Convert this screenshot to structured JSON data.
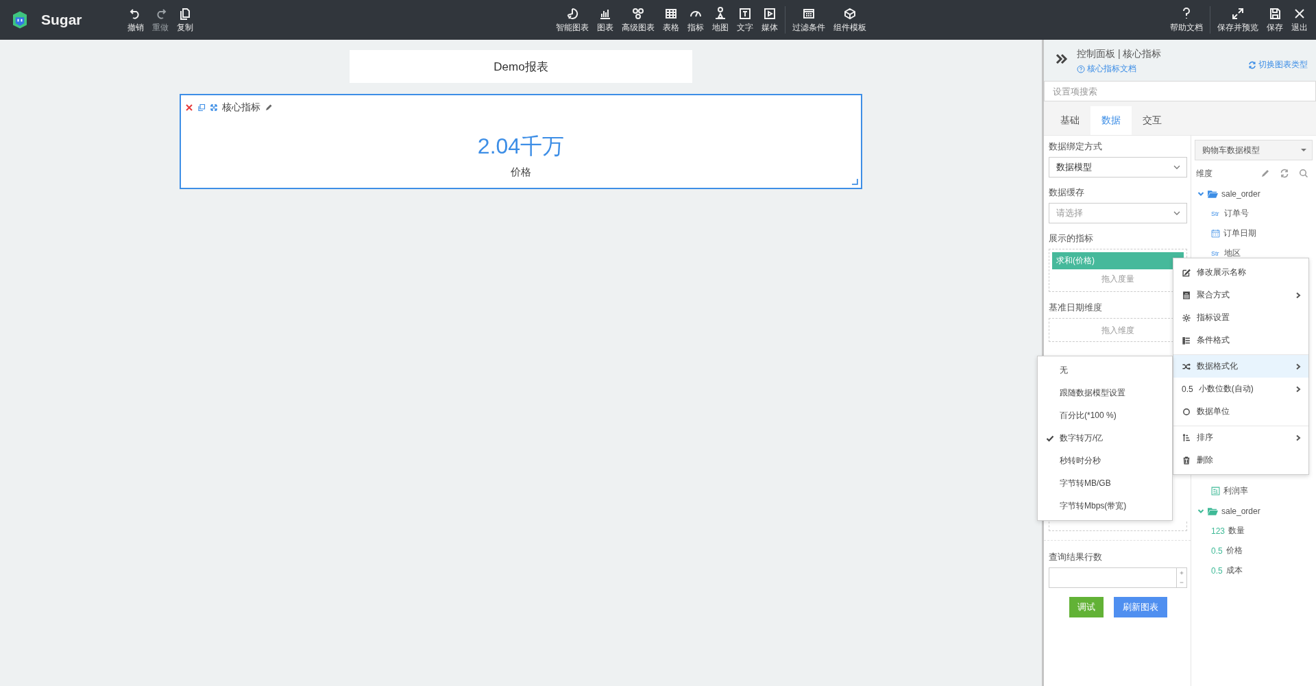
{
  "app": {
    "name": "Sugar"
  },
  "toolbar": {
    "left": [
      {
        "label": "撤销",
        "disabled": false
      },
      {
        "label": "重做",
        "disabled": true
      },
      {
        "label": "复制",
        "disabled": false
      }
    ],
    "center": [
      [
        {
          "label": "智能图表"
        },
        {
          "label": "图表"
        },
        {
          "label": "高级图表"
        },
        {
          "label": "表格"
        },
        {
          "label": "指标"
        },
        {
          "label": "地图"
        },
        {
          "label": "文字"
        },
        {
          "label": "媒体"
        }
      ],
      [
        {
          "label": "过滤条件"
        },
        {
          "label": "组件模板"
        }
      ]
    ],
    "right": [
      [
        {
          "label": "帮助文档"
        }
      ],
      [
        {
          "label": "保存并预览"
        },
        {
          "label": "保存"
        },
        {
          "label": "退出"
        }
      ]
    ]
  },
  "report": {
    "title": "Demo报表",
    "widget": {
      "title": "核心指标",
      "value": "2.04千万",
      "caption": "价格",
      "selected": true
    }
  },
  "panel": {
    "title": "控制面板 | 核心指标",
    "doc_link": "核心指标文档",
    "switch_link": "切换图表类型",
    "search": {
      "placeholder": "设置项搜索"
    },
    "tabs": [
      {
        "label": "基础",
        "selected": false
      },
      {
        "label": "数据",
        "selected": true
      },
      {
        "label": "交互",
        "selected": false
      }
    ],
    "settings": {
      "binding": {
        "label": "数据绑定方式",
        "value": "数据模型"
      },
      "cache": {
        "label": "数据缓存",
        "placeholder": "请选择"
      },
      "metrics": {
        "label": "展示的指标",
        "chips": [
          "求和(价格)"
        ],
        "drop_hint": "拖入度量"
      },
      "date_dim": {
        "label": "基准日期维度",
        "drop_hint": "拖入维度"
      },
      "row_limit": {
        "label": "查询结果行数"
      },
      "buttons": [
        {
          "label": "调试",
          "kind": "success"
        },
        {
          "label": "刷新图表",
          "kind": "primary"
        }
      ]
    },
    "model": {
      "selected": "购物车数据模型",
      "dimensions_label": "维度",
      "tree": [
        {
          "kind": "folder",
          "label": "sale_order",
          "expanded": true,
          "color": "#3d8ee6",
          "children": [
            {
              "kind": "tag",
              "tag": "Str",
              "label": "订单号"
            },
            {
              "kind": "date",
              "label": "订单日期"
            },
            {
              "kind": "tag",
              "tag": "Str",
              "label": "地区"
            }
          ]
        },
        {
          "kind": "calc",
          "label": "利润率"
        },
        {
          "kind": "folder",
          "label": "sale_order",
          "expanded": true,
          "color": "#3fba97",
          "children": [
            {
              "kind": "tag",
              "tag": "123",
              "label": "数量"
            },
            {
              "kind": "tag",
              "tag": "0.5",
              "label": "价格"
            },
            {
              "kind": "tag",
              "tag": "0.5",
              "label": "成本"
            }
          ]
        }
      ]
    }
  },
  "context_menu": {
    "items": [
      {
        "label": "修改展示名称",
        "submenu": false,
        "selected": false,
        "divider_before": false
      },
      {
        "label": "聚合方式",
        "submenu": true,
        "selected": false,
        "divider_before": false
      },
      {
        "label": "指标设置",
        "submenu": false,
        "selected": false,
        "divider_before": false
      },
      {
        "label": "条件格式",
        "submenu": false,
        "selected": false,
        "divider_before": false
      },
      {
        "label": "数据格式化",
        "submenu": true,
        "selected": true,
        "divider_before": true
      },
      {
        "label": "小数位数(自动)",
        "prefix": "0.5",
        "submenu": true,
        "selected": false,
        "divider_before": false
      },
      {
        "label": "数据单位",
        "submenu": false,
        "selected": false,
        "divider_before": false
      },
      {
        "label": "排序",
        "submenu": true,
        "selected": false,
        "divider_before": true
      },
      {
        "label": "删除",
        "submenu": false,
        "selected": false,
        "divider_before": false
      }
    ]
  },
  "format_submenu": {
    "items": [
      {
        "label": "无",
        "checked": false
      },
      {
        "label": "跟随数据模型设置",
        "checked": false
      },
      {
        "label": "百分比(*100 %)",
        "checked": false
      },
      {
        "label": "数字转万/亿",
        "checked": true
      },
      {
        "label": "秒转时分秒",
        "checked": false
      },
      {
        "label": "字节转MB/GB",
        "checked": false
      },
      {
        "label": "字节转Mbps(带宽)",
        "checked": false
      }
    ]
  }
}
